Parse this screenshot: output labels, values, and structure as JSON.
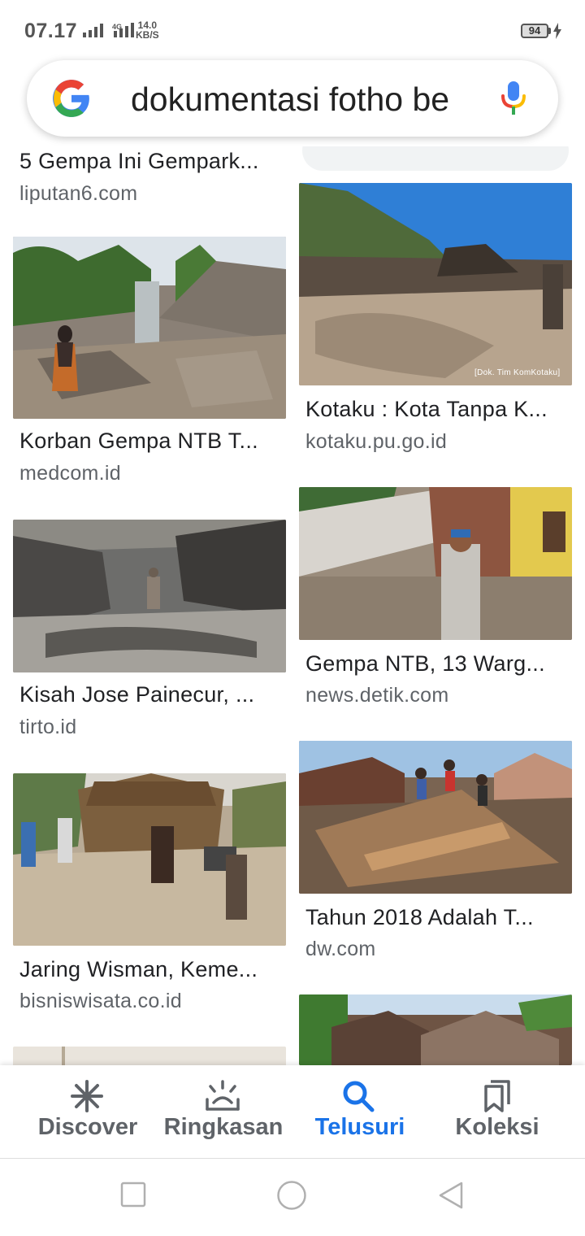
{
  "status": {
    "time": "07.17",
    "net_tag": "4G",
    "net_speed_value": "14.0",
    "net_speed_unit": "KB/S",
    "battery": "94"
  },
  "search": {
    "query": "dokumentasi fotho be"
  },
  "results": [
    {
      "title": "5 Gempa Ini Gempark...",
      "source": "liputan6.com"
    },
    {
      "title": "Korban Gempa NTB T...",
      "source": "medcom.id"
    },
    {
      "title": "Kisah Jose Painecur, ...",
      "source": "tirto.id"
    },
    {
      "title": "Jaring Wisman, Keme...",
      "source": "bisniswisata.co.id"
    },
    {
      "title": "Kotaku : Kota Tanpa K...",
      "source": "kotaku.pu.go.id",
      "watermark": "[Dok. Tim KomKotaku]"
    },
    {
      "title": "Gempa NTB, 13 Warg...",
      "source": "news.detik.com"
    },
    {
      "title": "Tahun 2018 Adalah T...",
      "source": "dw.com"
    }
  ],
  "bottom_nav": [
    {
      "label": "Discover",
      "icon": "asterisk-icon",
      "active": false
    },
    {
      "label": "Ringkasan",
      "icon": "sunrise-icon",
      "active": false
    },
    {
      "label": "Telusuri",
      "icon": "search-icon",
      "active": true
    },
    {
      "label": "Koleksi",
      "icon": "bookmark-stack-icon",
      "active": false
    }
  ],
  "colors": {
    "accent": "#1a73e8",
    "text_primary": "#202124",
    "text_secondary": "#5f6368"
  }
}
